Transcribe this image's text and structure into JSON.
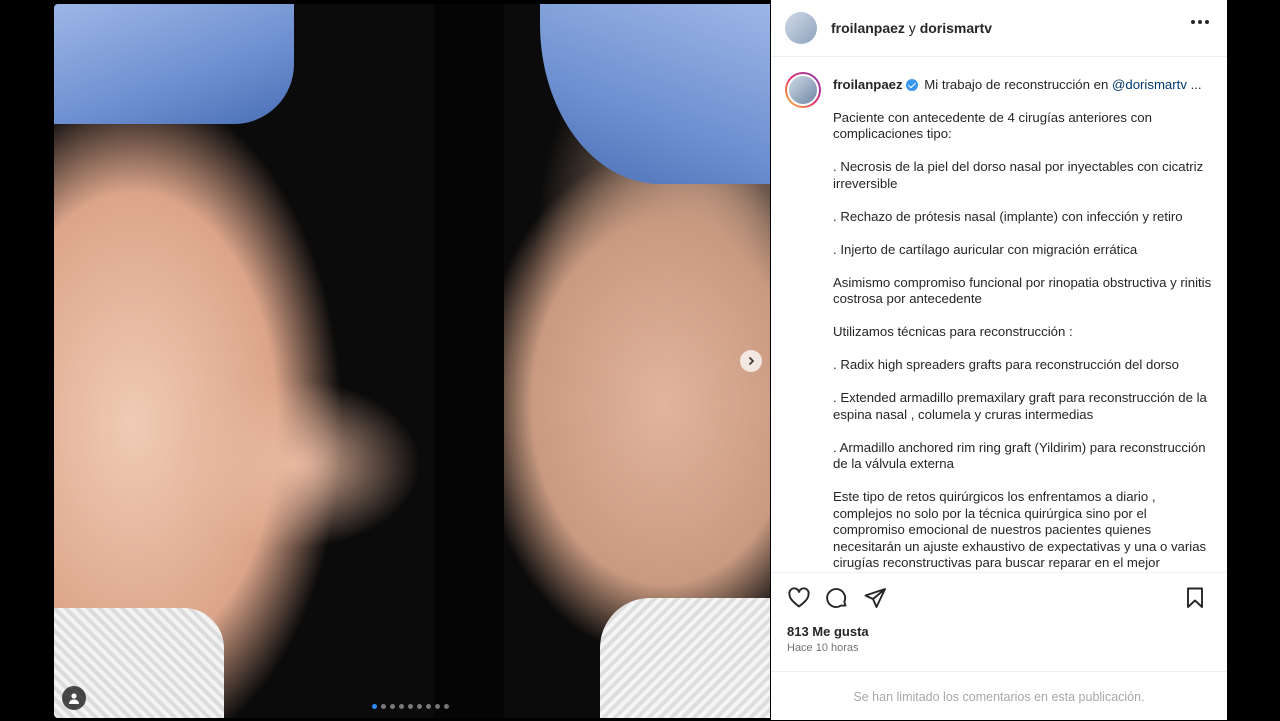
{
  "header": {
    "author": "froilanpaez",
    "joiner": "y",
    "collaborator": "dorismartv"
  },
  "caption": {
    "username": "froilanpaez",
    "first_line": "Mi trabajo de reconstrucción en",
    "mention": "@dorismartv",
    "ellipsis": "...",
    "paragraphs": [
      "Paciente con antecedente de 4 cirugías anteriores con complicaciones tipo:",
      ". Necrosis de la piel del dorso nasal por inyectables con cicatriz irreversible",
      ". Rechazo de prótesis nasal (implante) con infección y retiro",
      ". Injerto de cartílago auricular con migración errática",
      "Asimismo compromiso funcional por rinopatia obstructiva y rinitis costrosa por antecedente",
      "Utilizamos técnicas para reconstrucción :",
      ". Radix high spreaders grafts para reconstrucción del dorso",
      ". Extended armadillo premaxilary graft para reconstrucción de la espina nasal , columela y cruras intermedias",
      ". Armadillo anchored rim ring graft (Yildirim) para reconstrucción de la válvula externa",
      "Este tipo de retos quirúrgicos los enfrentamos a diario , complejos no solo por la técnica quirúrgica sino por el compromiso emocional de nuestros pacientes quienes necesitarán un ajuste exhaustivo de expectativas y una o varias cirugías reconstructivas para buscar reparar en el mejor"
    ]
  },
  "stats": {
    "likes": "813 Me gusta",
    "time": "Hace 10 horas"
  },
  "footer": {
    "comments_disabled": "Se han limitado los comentarios en esta publicación."
  },
  "carousel": {
    "slide_count": 9,
    "active_index": 0
  },
  "colors": {
    "accent": "#3897f0",
    "mention": "#00376b",
    "muted": "#737373"
  }
}
